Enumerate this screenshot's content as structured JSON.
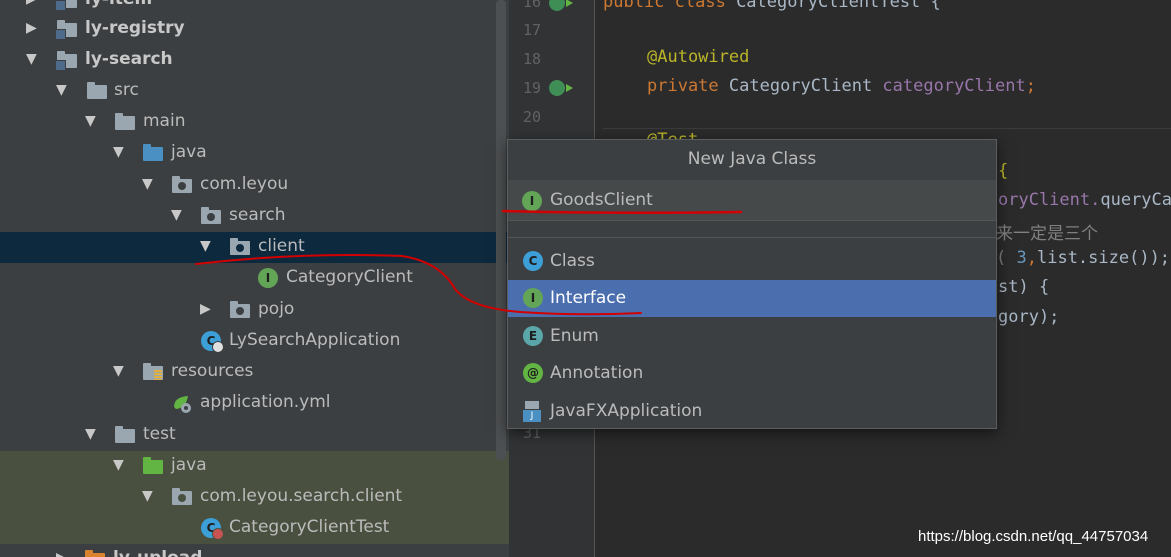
{
  "tree": {
    "items": [
      {
        "label": "ly-item"
      },
      {
        "label": "ly-registry"
      },
      {
        "label": "ly-search"
      },
      {
        "label": "src"
      },
      {
        "label": "main"
      },
      {
        "label": "java"
      },
      {
        "label": "com.leyou"
      },
      {
        "label": "search"
      },
      {
        "label": "client"
      },
      {
        "label": "CategoryClient"
      },
      {
        "label": "pojo"
      },
      {
        "label": "LySearchApplication"
      },
      {
        "label": "resources"
      },
      {
        "label": "application.yml"
      },
      {
        "label": "test"
      },
      {
        "label": "java"
      },
      {
        "label": "com.leyou.search.client"
      },
      {
        "label": "CategoryClientTest"
      },
      {
        "label": "ly-upload"
      }
    ],
    "selected": "client"
  },
  "editor": {
    "line_numbers": [
      "16",
      "17",
      "18",
      "19",
      "20",
      "31"
    ],
    "lines": {
      "l16": {
        "kw": "public class ",
        "name": "CategoryClientTest {"
      },
      "l18": {
        "ann": "@Autowired"
      },
      "l19": {
        "kw": "private ",
        "type": "CategoryClient ",
        "field": "categoryClient",
        ";": ";"
      },
      "l21": {
        "ann": "@Test"
      },
      "l22": {
        "text": "{"
      },
      "l23": {
        "a": "oryClient.",
        "b": "queryCa"
      },
      "l24": {
        "cmt": "来一定是三个"
      },
      "l25": {
        "a": "( ",
        "num": "3",
        ",": ",",
        "b": "list.size());"
      },
      "l26": {
        "text": "st) {"
      },
      "l27": {
        "text": "gory);"
      }
    }
  },
  "dialog": {
    "title": "New Java Class",
    "name_value": "GoodsClient",
    "kinds": [
      {
        "label": "Class",
        "icon": "class-icon"
      },
      {
        "label": "Interface",
        "icon": "interface-icon"
      },
      {
        "label": "Enum",
        "icon": "enum-icon"
      },
      {
        "label": "Annotation",
        "icon": "annotation-icon"
      },
      {
        "label": "JavaFXApplication",
        "icon": "javafx-icon"
      }
    ],
    "selected_kind": "Interface"
  },
  "icon_glyphs": {
    "interface": "I",
    "class": "C",
    "enum": "E",
    "annotation": "@"
  },
  "colors": {
    "selection": "#4b6eaf",
    "tree_selection": "#0d293e",
    "annotation_ink": "#d20000"
  },
  "watermark": "https://blog.csdn.net/qq_44757034"
}
